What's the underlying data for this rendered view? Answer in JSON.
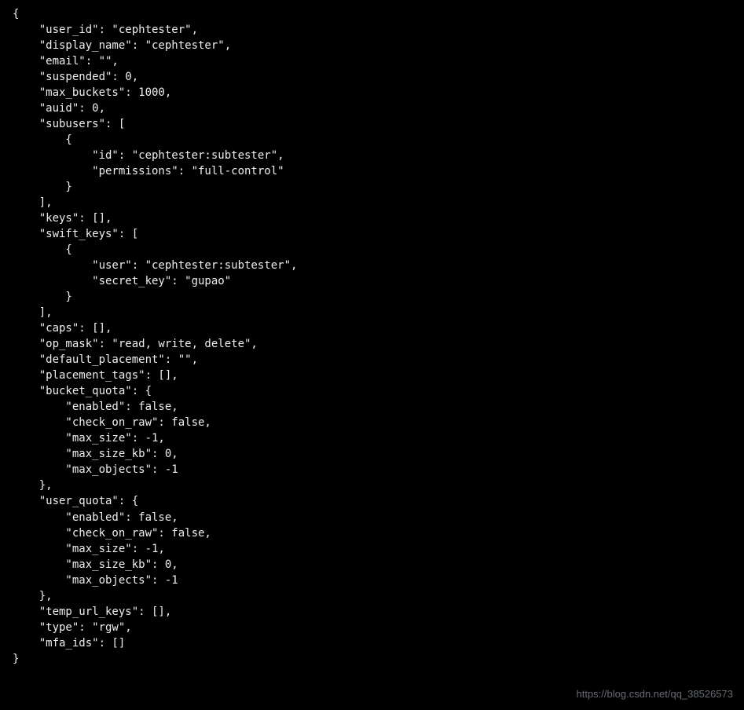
{
  "jsonText": "{\n    \"user_id\": \"cephtester\",\n    \"display_name\": \"cephtester\",\n    \"email\": \"\",\n    \"suspended\": 0,\n    \"max_buckets\": 1000,\n    \"auid\": 0,\n    \"subusers\": [\n        {\n            \"id\": \"cephtester:subtester\",\n            \"permissions\": \"full-control\"\n        }\n    ],\n    \"keys\": [],\n    \"swift_keys\": [\n        {\n            \"user\": \"cephtester:subtester\",\n            \"secret_key\": \"gupao\"\n        }\n    ],\n    \"caps\": [],\n    \"op_mask\": \"read, write, delete\",\n    \"default_placement\": \"\",\n    \"placement_tags\": [],\n    \"bucket_quota\": {\n        \"enabled\": false,\n        \"check_on_raw\": false,\n        \"max_size\": -1,\n        \"max_size_kb\": 0,\n        \"max_objects\": -1\n    },\n    \"user_quota\": {\n        \"enabled\": false,\n        \"check_on_raw\": false,\n        \"max_size\": -1,\n        \"max_size_kb\": 0,\n        \"max_objects\": -1\n    },\n    \"temp_url_keys\": [],\n    \"type\": \"rgw\",\n    \"mfa_ids\": []\n}",
  "watermark": "https://blog.csdn.net/qq_38526573",
  "data": {
    "user_id": "cephtester",
    "display_name": "cephtester",
    "email": "",
    "suspended": 0,
    "max_buckets": 1000,
    "auid": 0,
    "subusers": [
      {
        "id": "cephtester:subtester",
        "permissions": "full-control"
      }
    ],
    "keys": [],
    "swift_keys": [
      {
        "user": "cephtester:subtester",
        "secret_key": "gupao"
      }
    ],
    "caps": [],
    "op_mask": "read, write, delete",
    "default_placement": "",
    "placement_tags": [],
    "bucket_quota": {
      "enabled": false,
      "check_on_raw": false,
      "max_size": -1,
      "max_size_kb": 0,
      "max_objects": -1
    },
    "user_quota": {
      "enabled": false,
      "check_on_raw": false,
      "max_size": -1,
      "max_size_kb": 0,
      "max_objects": -1
    },
    "temp_url_keys": [],
    "type": "rgw",
    "mfa_ids": []
  }
}
